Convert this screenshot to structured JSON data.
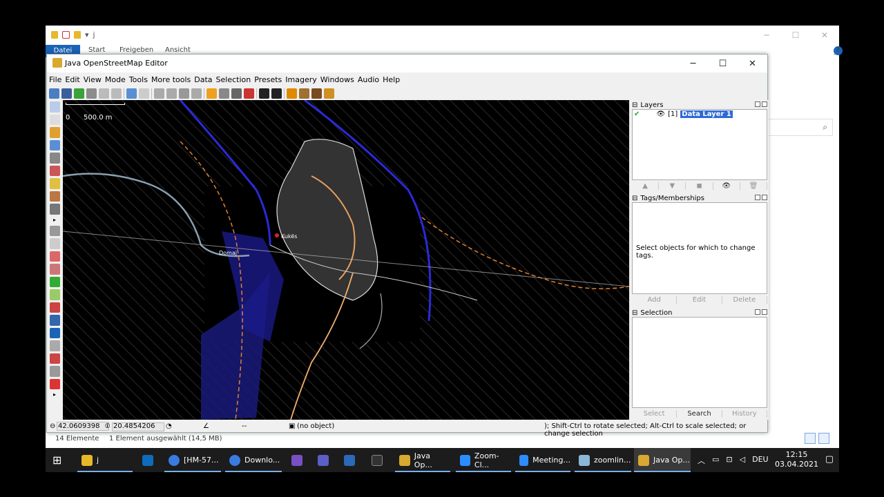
{
  "explorer": {
    "quick_access": "j",
    "ribbon_tabs": [
      "Datei",
      "Start",
      "Freigeben",
      "Ansicht"
    ],
    "status_left": "14 Elemente",
    "status_mid": "1 Element ausgewählt (14,5 MB)",
    "wc_min": "─",
    "wc_max": "☐",
    "wc_close": "✕"
  },
  "josm": {
    "title": "Java OpenStreetMap Editor",
    "menu": [
      "File",
      "Edit",
      "View",
      "Mode",
      "Tools",
      "More tools",
      "Data",
      "Selection",
      "Presets",
      "Imagery",
      "Windows",
      "Audio",
      "Help"
    ],
    "scale_zero": "0",
    "scale_label": "500.0 m",
    "map_labels": {
      "town1": "Kukës",
      "town2": "Domaj"
    },
    "layers": {
      "title": "Layers",
      "row_index": "[1]",
      "row_name": "Data Layer 1"
    },
    "tags": {
      "title": "Tags/Memberships",
      "empty_text": "Select objects for which to change tags.",
      "buttons": [
        "Add",
        "Edit",
        "Delete"
      ]
    },
    "selection": {
      "title": "Selection",
      "buttons": [
        "Select",
        "Search",
        "History"
      ]
    },
    "status": {
      "lat": "42.0609398",
      "lon": "20.4854206",
      "dist": "--",
      "object": "(no object)",
      "hint": "); Shift-Ctrl to rotate selected; Alt-Ctrl to scale selected; or change selection"
    }
  },
  "taskbar": {
    "items": [
      "j",
      "",
      "[HM-57...",
      "Downlo...",
      "",
      "",
      "",
      "",
      "Java Op...",
      "Zoom-Cl...",
      "Meeting...",
      "zoomlin...",
      "Java Op..."
    ],
    "lang": "DEU",
    "time": "12:15",
    "date": "03.04.2021"
  },
  "colors": {
    "accent": "#1a64b8",
    "map_bg": "#000000",
    "layer_select": "#2e6ad6"
  }
}
